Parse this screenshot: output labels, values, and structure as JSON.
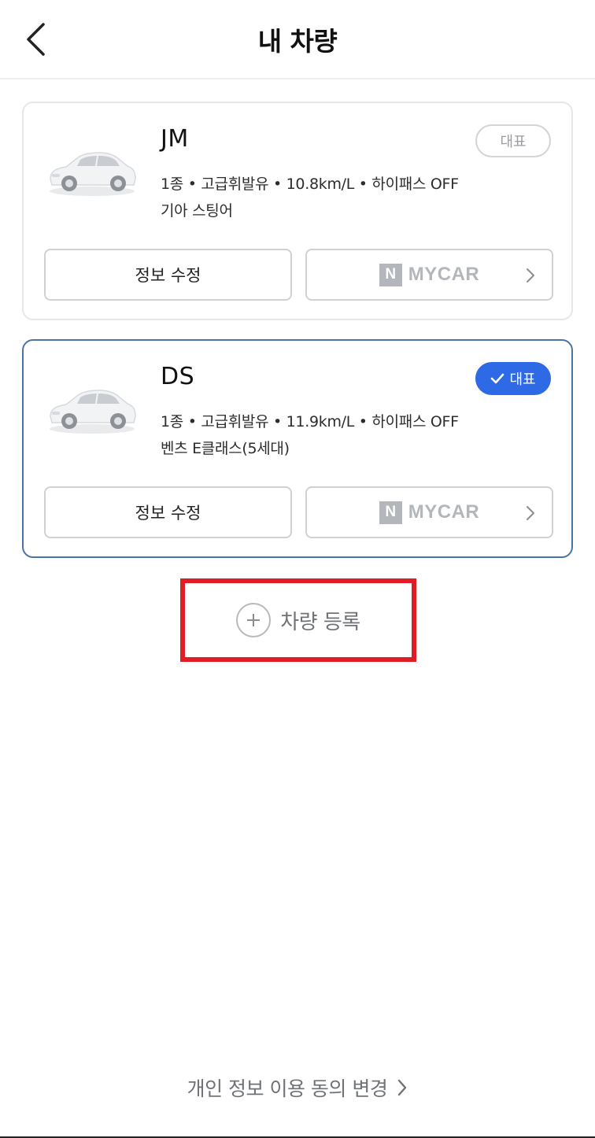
{
  "header": {
    "title": "내 차량",
    "back_icon": "chevron-left-icon"
  },
  "vehicles": [
    {
      "name": "JM",
      "spec": "1종 • 고급휘발유 • 10.8km/L • 하이패스 OFF",
      "model": "기아 스팅어",
      "badge_label": "대표",
      "is_primary": false,
      "edit_label": "정보 수정",
      "mycar_n": "N",
      "mycar_label": "MYCAR"
    },
    {
      "name": "DS",
      "spec": "1종 • 고급휘발유 • 11.9km/L • 하이패스 OFF",
      "model": "벤츠 E클래스(5세대)",
      "badge_label": "대표",
      "is_primary": true,
      "edit_label": "정보 수정",
      "mycar_n": "N",
      "mycar_label": "MYCAR"
    }
  ],
  "add_vehicle": {
    "label": "차량 등록",
    "icon": "plus-circle-icon"
  },
  "footer": {
    "privacy_link": "개인 정보 이용 동의 변경"
  },
  "colors": {
    "primary_blue": "#2f6ae6",
    "selected_border": "#4a74a6",
    "highlight_red": "#e01d25",
    "muted_gray": "#b3b6bb"
  }
}
